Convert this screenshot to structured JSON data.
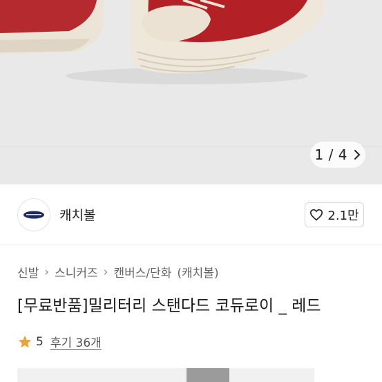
{
  "gallery": {
    "current": "1",
    "separator": "/",
    "total": "4"
  },
  "brand": {
    "name": "캐치볼",
    "likes_label": "2.1만"
  },
  "breadcrumb": [
    "신발",
    "스니커즈",
    "캔버스/단화",
    "(캐치볼)"
  ],
  "product": {
    "title": "[무료반품]밀리터리 스탠다드 코듀로이 _ 레드",
    "rating": "5",
    "reviews_label": "후기 36개"
  },
  "colors": {
    "accent_star": "#E8A33D",
    "shoe_red": "#B2222A",
    "sole_cream": "#EDE6D8",
    "logo_navy": "#1F2B5C"
  }
}
